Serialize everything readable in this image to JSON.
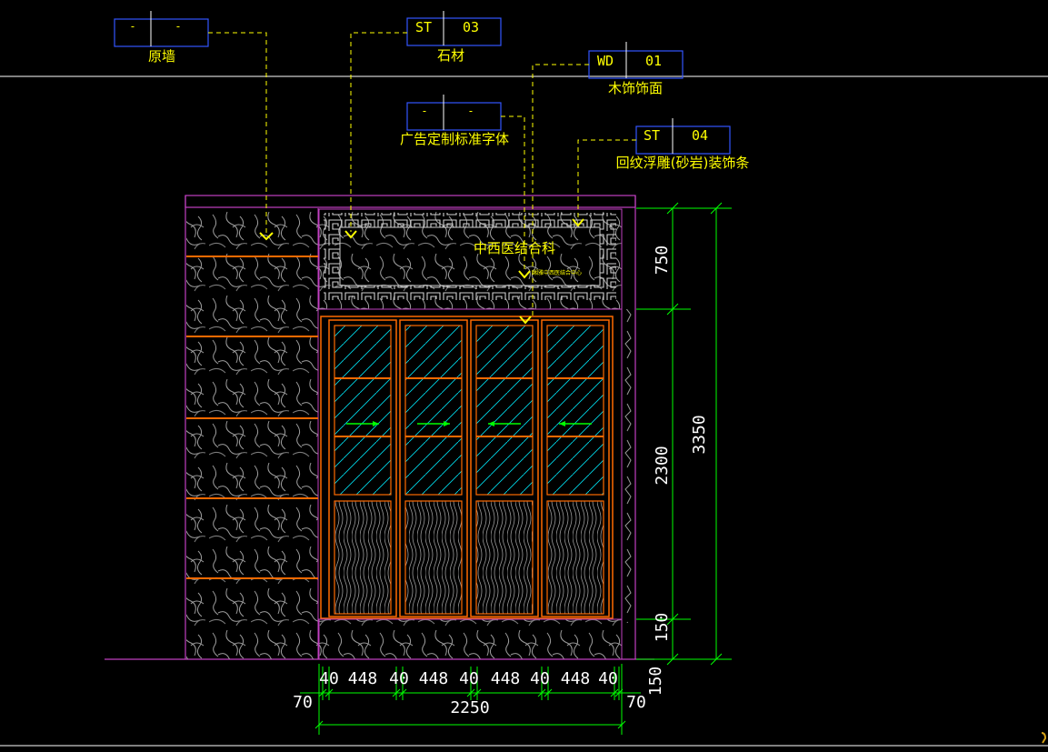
{
  "drawing": {
    "tags": [
      {
        "code": "-",
        "num": "-",
        "label": "原墙"
      },
      {
        "code": "ST",
        "num": "03",
        "label": "石材"
      },
      {
        "code": "WD",
        "num": "01",
        "label": "木饰饰面"
      },
      {
        "code": "-",
        "num": "-",
        "label": "广告定制标准字体"
      },
      {
        "code": "ST",
        "num": "04",
        "label": "回纹浮雕(砂岩)装饰条"
      }
    ],
    "sign_text": "中西医结合科",
    "sign_small_text": "湘雅中西医结合中心",
    "dimensions": {
      "horizontal": [
        "40",
        "448",
        "40",
        "448",
        "40",
        "448",
        "40",
        "448",
        "40"
      ],
      "side_left": "70",
      "side_right": "70",
      "overall_width": "2250",
      "bottom_right": "150",
      "vertical_inner": [
        "750",
        "2300",
        "150"
      ],
      "vertical_total": "3350"
    },
    "colors": {
      "background": "#000000",
      "frame": "#ff6a00",
      "border": "#c040c0",
      "dimension": "#00ff00",
      "annotation": "#ffff00",
      "tag_box": "#3355ff",
      "leader": "#ffffff",
      "glass": "#00ffff",
      "arrow": "#00ff00"
    }
  }
}
